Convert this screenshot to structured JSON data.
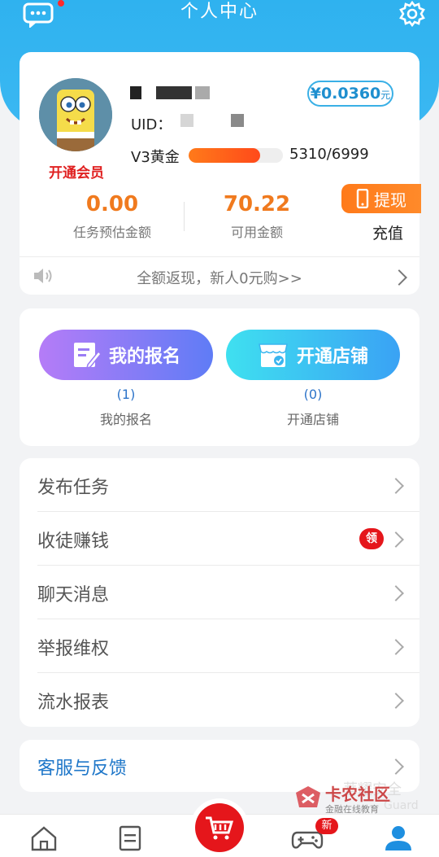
{
  "header": {
    "title": "个人中心"
  },
  "profile": {
    "uid_label": "UID：",
    "vip_link": "开通会员",
    "level_label": "V3黄金",
    "level_progress_text": "5310/6999",
    "level_progress_fraction": 0.7587,
    "coin_balance": "¥0.0360",
    "coin_unit": "元"
  },
  "stats": {
    "estimated_value": "0.00",
    "estimated_label": "任务预估金额",
    "available_value": "70.22",
    "available_label": "可用金额",
    "withdraw_label": "提现",
    "recharge_label": "充值"
  },
  "notice": {
    "text": "全额返现，新人0元购>>"
  },
  "signup": {
    "my_signup_button": "我的报名",
    "my_signup_count": "(1)",
    "my_signup_label": "我的报名",
    "open_shop_button": "开通店铺",
    "open_shop_count": "(0)",
    "open_shop_label": "开通店铺"
  },
  "menu": [
    {
      "label": "发布任务"
    },
    {
      "label": "收徒赚钱",
      "badge": "领"
    },
    {
      "label": "聊天消息"
    },
    {
      "label": "举报维权"
    },
    {
      "label": "流水报表"
    }
  ],
  "service": {
    "label": "客服与反馈"
  },
  "watermark": {
    "brand": "卡农社区",
    "sub": "金融在线教育",
    "faint1": "菩耀安全",
    "faint2": "Guard"
  },
  "tabbar": {
    "game_badge": "新"
  },
  "colors": {
    "primary_blue": "#2fb2ef",
    "accent_orange": "#f07a1e",
    "danger_red": "#e5161b"
  },
  "icons": [
    "message-icon",
    "gear-icon",
    "speaker-icon",
    "chevron-right-icon",
    "edit-icon",
    "shop-icon",
    "phone-icon",
    "home-icon",
    "list-icon",
    "cart-icon",
    "gamepad-icon",
    "user-icon"
  ]
}
